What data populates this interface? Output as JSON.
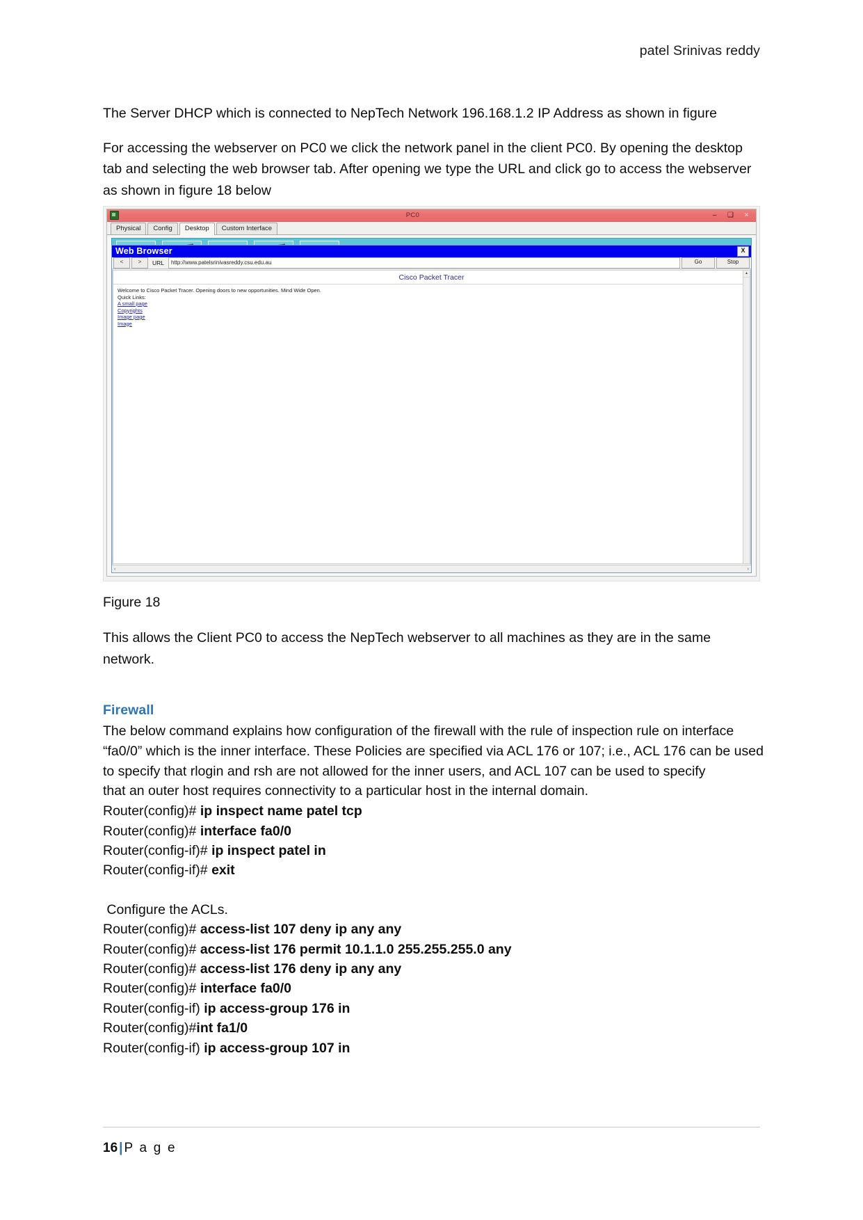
{
  "header": {
    "author": "patel Srinivas reddy"
  },
  "body": {
    "para1": "The Server DHCP which is connected to NepTech Network 196.168.1.2 IP Address as shown in figure",
    "para2": "For accessing the webserver on PC0 we click the network panel in the client PC0. By opening the desktop tab and selecting the web browser tab. After opening we type the URL and click go to access the webserver as shown in figure 18 below",
    "figure_caption": "Figure 18",
    "para3": "This allows the Client PC0 to access the NepTech webserver to all machines as they are in the same network."
  },
  "figure": {
    "window_title": "PC0",
    "window_buttons": {
      "minimize": "–",
      "maximize": "❑",
      "close": "×"
    },
    "tabs": [
      {
        "label": "Physical",
        "active": false
      },
      {
        "label": "Config",
        "active": false
      },
      {
        "label": "Desktop",
        "active": true
      },
      {
        "label": "Custom Interface",
        "active": false
      }
    ],
    "browser": {
      "title": "Web Browser",
      "close_label": "X",
      "back_label": "<",
      "forward_label": ">",
      "url_label": "URL",
      "url_value": "http://www.patelsrinivasreddy.csu.edu.au",
      "go_label": "Go",
      "stop_label": "Stop",
      "page": {
        "heading": "Cisco Packet Tracer",
        "welcome": "Welcome to Cisco Packet Tracer. Opening doors to new opportunities. Mind Wide Open.",
        "quick_links_label": "Quick Links:",
        "links": [
          "A small page",
          "Copyrights",
          "Image page",
          "Image"
        ]
      },
      "scroll_left_arrow": "‹",
      "scroll_right_arrow": "›",
      "scroll_up_arrow": "▴",
      "scroll_down_arrow": "▾"
    }
  },
  "firewall": {
    "title": "Firewall",
    "intro": "The below command explains how configuration of the firewall with the rule of inspection rule on interface “fa0/0” which is the inner interface. These Policies are specified via ACL 176 or 107; i.e., ACL 176 can be used to specify that rlogin and rsh are not allowed for the inner users, and ACL 107 can be used to specify",
    "intro2": "that an outer host requires connectivity to a particular host in the internal domain.",
    "commands1": [
      {
        "prompt": "Router(config)# ",
        "cmd": "ip inspect name patel tcp"
      },
      {
        "prompt": "Router(config)# ",
        "cmd": "interface fa0/0"
      },
      {
        "prompt": "Router(config-if)# ",
        "cmd": "ip inspect patel in"
      },
      {
        "prompt": "Router(config-if)# ",
        "cmd": "exit"
      }
    ],
    "acl_heading": " Configure the ACLs.",
    "commands2": [
      {
        "prompt": "Router(config)# ",
        "cmd": "access-list 107 deny ip any any"
      },
      {
        "prompt": "Router(config)# ",
        "cmd": "access-list 176 permit 10.1.1.0 255.255.255.0 any"
      },
      {
        "prompt": "Router(config)# ",
        "cmd": "access-list 176 deny ip any any"
      },
      {
        "prompt": "Router(config)# ",
        "cmd": "interface fa0/0"
      },
      {
        "prompt": "Router(config-if) ",
        "cmd": "ip access-group 176 in"
      },
      {
        "prompt": "Router(config)#",
        "cmd": "int fa1/0"
      },
      {
        "prompt": "Router(config-if) ",
        "cmd": "ip access-group 107 in"
      }
    ]
  },
  "footer": {
    "page_number": "16",
    "separator": "|",
    "page_word": "P a g e"
  },
  "colors": {
    "heading_blue": "#2e74b5",
    "titlebar_red": "#ec6f6f",
    "browser_blue": "#0000ee",
    "desktop_cyan": "#5ec4d6",
    "link_blue": "#2323b5"
  }
}
